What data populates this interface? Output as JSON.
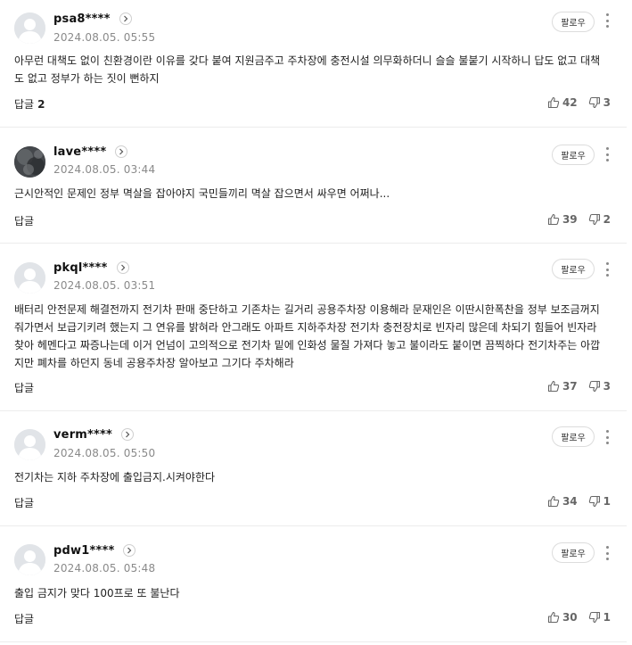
{
  "follow_label": "팔로우",
  "reply_label": "답글",
  "comments": [
    {
      "nickname": "psa8****",
      "timestamp": "2024.08.05. 05:55",
      "text": "아무런 대책도 없이 친환경이란 이유를 갖다 붙여 지원금주고 주차장에 충전시설 의무화하더니 슬슬 불붙기 시작하니 답도 없고 대책\n도 없고 정부가 하는 짓이 뻔하지",
      "reply_count": "2",
      "likes": "42",
      "dislikes": "3"
    },
    {
      "nickname": "lave****",
      "timestamp": "2024.08.05. 03:44",
      "text": "근시안적인 문제인 정부 멱살을 잡아야지 국민들끼리 멱살 잡으면서 싸우면 어쩌나...",
      "reply_count": "",
      "likes": "39",
      "dislikes": "2"
    },
    {
      "nickname": "pkql****",
      "timestamp": "2024.08.05. 03:51",
      "text": "배터리 안전문제 해결전까지 전기차 판매 중단하고 기존차는 길거리 공용주차장 이용해라 문재인은 이딴시한폭찬을 정부 보조금꺼지\n줘가면서 보급기키려 했는지 그 연유를 밝혀라 안그래도 아파트 지하주차장 전기차 충전장치로 빈자리 많은데 차되기 힘들어 빈자라\n찾아 헤멘다고 짜증나는데 이거 언넘이 고의적으로 전기차 밑에 인화성 물질 가져다 놓고 불이라도 붙이면 끔찍하다 전기차주는 아깝\n지만 폐차를 하던지 동네 공용주차장 알아보고 그기다 주차해라",
      "reply_count": "",
      "likes": "37",
      "dislikes": "3"
    },
    {
      "nickname": "verm****",
      "timestamp": "2024.08.05. 05:50",
      "text": "전기차는 지하 주차장에 출입금지.시켜야한다",
      "reply_count": "",
      "likes": "34",
      "dislikes": "1"
    },
    {
      "nickname": "pdw1****",
      "timestamp": "2024.08.05. 05:48",
      "text": "출입 금지가 맞다 100프로 또 불난다",
      "reply_count": "",
      "likes": "30",
      "dislikes": "1"
    }
  ]
}
